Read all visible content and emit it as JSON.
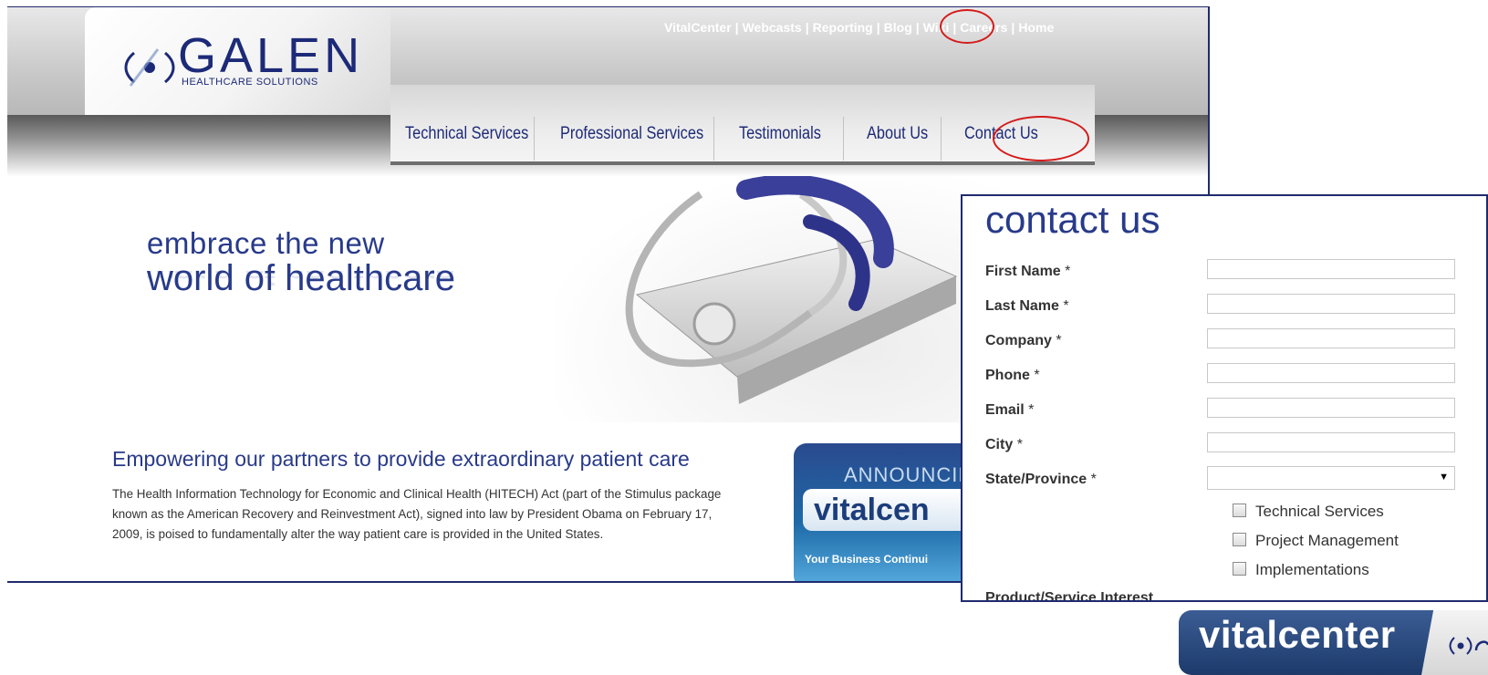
{
  "header": {
    "logo_text": "GALEN",
    "logo_subtitle": "HEALTHCARE SOLUTIONS",
    "top_links": [
      "VitalCenter",
      "Webcasts",
      "Reporting",
      "Blog",
      "Wiki",
      "Careers",
      "Home"
    ],
    "top_link_separator": "|"
  },
  "nav": {
    "items": [
      "Technical Services",
      "Professional Services",
      "Testimonials",
      "About Us",
      "Contact Us"
    ]
  },
  "hero": {
    "tagline_line1": "embrace the new",
    "tagline_line2": "world of healthcare"
  },
  "content": {
    "headline": "Empowering our partners to provide extraordinary patient care",
    "body": "The Health Information Technology for Economic and Clinical Health (HITECH) Act (part of the Stimulus package known as the American Recovery and Reinvestment Act), signed into law by President Obama on February 17, 2009, is poised to fundamentally alter the way patient care is provided in the United States."
  },
  "announcement": {
    "title": "ANNOUNCIN",
    "brand": "vitalcen",
    "tagline": "Your Business Continui"
  },
  "contact_form": {
    "title": "contact us",
    "required_marker": "*",
    "fields": [
      {
        "label": "First Name",
        "value": ""
      },
      {
        "label": "Last Name",
        "value": ""
      },
      {
        "label": "Company",
        "value": ""
      },
      {
        "label": "Phone",
        "value": ""
      },
      {
        "label": "Email",
        "value": ""
      },
      {
        "label": "City",
        "value": ""
      }
    ],
    "state_field": {
      "label": "State/Province",
      "selected": ""
    },
    "interests": [
      "Technical Services",
      "Project Management",
      "Implementations"
    ],
    "cut_label": "Product/Service Interest"
  },
  "footer": {
    "brand": "vitalcenter"
  },
  "colors": {
    "brand_navy": "#283a8a",
    "highlight_red": "#d41b1b",
    "nav_underline": "#6e6e6e"
  }
}
